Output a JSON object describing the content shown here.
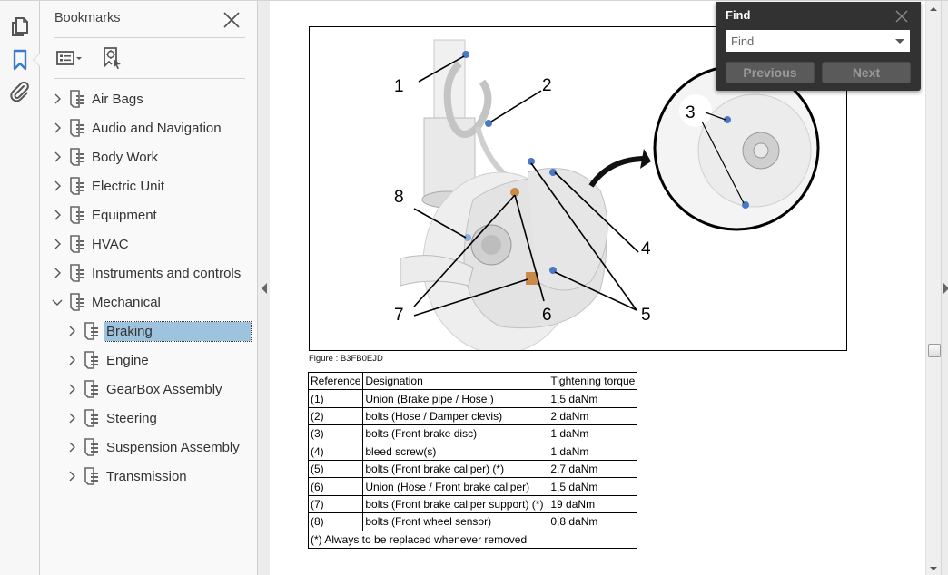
{
  "sidebar_rail": {
    "items": [
      {
        "name": "page-thumbnails",
        "icon": "pages-icon",
        "active": false
      },
      {
        "name": "bookmarks",
        "icon": "bookmark-icon",
        "active": true
      },
      {
        "name": "attachments",
        "icon": "paperclip-icon",
        "active": false
      }
    ]
  },
  "bookmarks_panel": {
    "title": "Bookmarks",
    "close_icon": "close-icon",
    "toolbar": {
      "options_icon": "list-options-icon",
      "new_bookmark_icon": "new-bookmark-icon"
    },
    "items": [
      {
        "label": "Air Bags",
        "level": 0,
        "expanded": false
      },
      {
        "label": "Audio and Navigation",
        "level": 0,
        "expanded": false
      },
      {
        "label": "Body Work",
        "level": 0,
        "expanded": false
      },
      {
        "label": "Electric Unit",
        "level": 0,
        "expanded": false
      },
      {
        "label": "Equipment",
        "level": 0,
        "expanded": false
      },
      {
        "label": "HVAC",
        "level": 0,
        "expanded": false
      },
      {
        "label": "Instruments and controls",
        "level": 0,
        "expanded": false
      },
      {
        "label": "Mechanical",
        "level": 0,
        "expanded": true
      },
      {
        "label": "Braking",
        "level": 1,
        "expanded": false,
        "selected": true
      },
      {
        "label": "Engine",
        "level": 1,
        "expanded": false
      },
      {
        "label": "GearBox Assembly",
        "level": 1,
        "expanded": false
      },
      {
        "label": "Steering",
        "level": 1,
        "expanded": false
      },
      {
        "label": "Suspension Assembly",
        "level": 1,
        "expanded": false
      },
      {
        "label": "Transmission",
        "level": 1,
        "expanded": false
      }
    ]
  },
  "document": {
    "figure": {
      "callouts": [
        "1",
        "2",
        "3",
        "4",
        "5",
        "6",
        "7",
        "8"
      ],
      "caption": "Figure : B3FB0EJD"
    },
    "table": {
      "headers": [
        "Reference",
        "Designation",
        "Tightening torque"
      ],
      "rows": [
        [
          "(1)",
          "Union (Brake pipe / Hose )",
          "1,5 daNm"
        ],
        [
          "(2)",
          "bolts (Hose / Damper clevis)",
          "2 daNm"
        ],
        [
          "(3)",
          "bolts (Front brake disc)",
          "1 daNm"
        ],
        [
          "(4)",
          "bleed screw(s)",
          "1 daNm"
        ],
        [
          "(5)",
          "bolts (Front brake caliper) (*)",
          "2,7 daNm"
        ],
        [
          "(6)",
          "Union (Hose / Front brake caliper)",
          "1,5 daNm"
        ],
        [
          "(7)",
          "bolts (Front brake caliper support) (*)",
          "19 daNm"
        ],
        [
          "(8)",
          "bolts (Front wheel sensor)",
          "0,8 daNm"
        ]
      ],
      "footnote": "(*) Always to be replaced whenever removed"
    }
  },
  "find": {
    "title": "Find",
    "placeholder": "Find",
    "value": "",
    "previous_label": "Previous",
    "next_label": "Next"
  },
  "colors": {
    "accent": "#3c7bc6",
    "selection": "#9ec3de",
    "find_bg": "#323232"
  }
}
